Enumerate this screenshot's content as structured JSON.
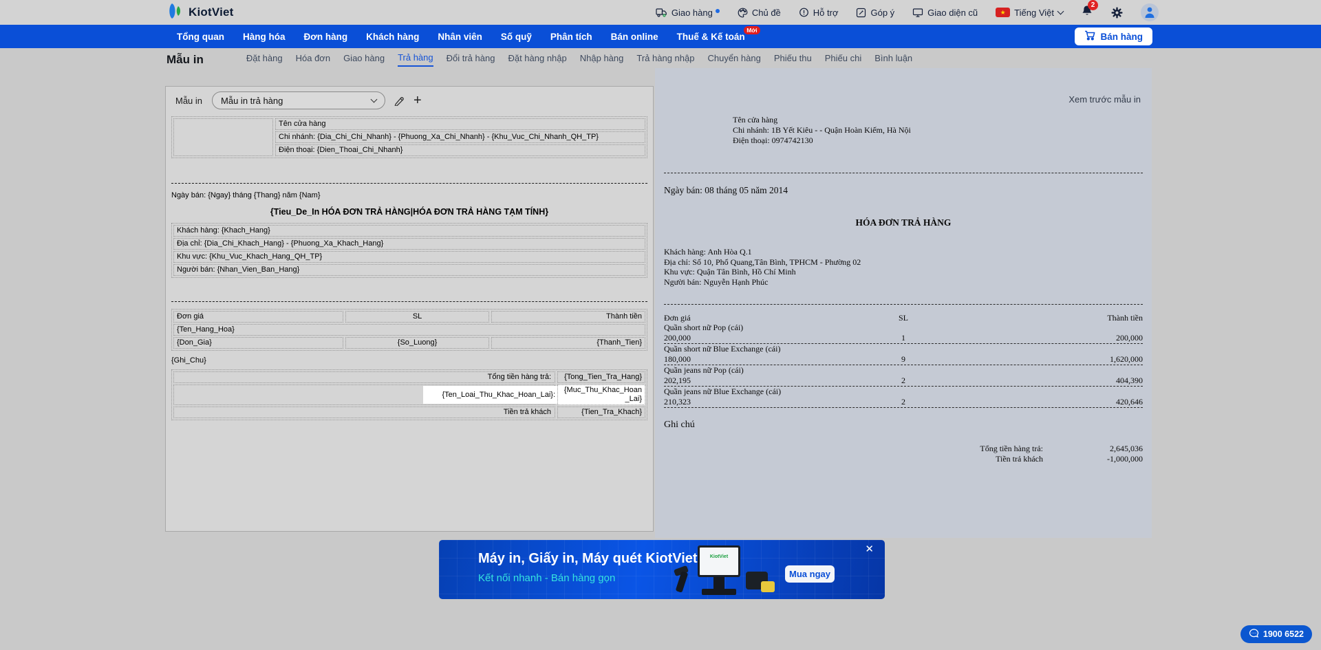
{
  "colors": {
    "accent_blue": "#0a4fd7",
    "topbar_bg": "#d3d3d3",
    "page_bg": "#c9c9c9",
    "editor_bg": "#d5d5d5",
    "preview_bg": "#c5cad4",
    "badge_red": "#e11d1d",
    "banner_cyan": "#35e3df"
  },
  "topbar": {
    "logo": "KiotViet",
    "menu": [
      {
        "label": "Giao hàng"
      },
      {
        "label": "Chủ đề"
      },
      {
        "label": "Hỗ trợ"
      },
      {
        "label": "Góp ý"
      },
      {
        "label": "Giao diện cũ"
      },
      {
        "label": "Tiếng Việt"
      }
    ],
    "flag_star": "★",
    "notification_count": "2"
  },
  "nav": {
    "items": [
      "Tổng quan",
      "Hàng hóa",
      "Đơn hàng",
      "Khách hàng",
      "Nhân viên",
      "Số quỹ",
      "Phân tích",
      "Bán online",
      "Thuế & Kế toán"
    ],
    "new_badge": "Mới",
    "sell_button": "Bán hàng"
  },
  "page": {
    "title": "Mẫu in",
    "tabs": [
      "Đặt hàng",
      "Hóa đơn",
      "Giao hàng",
      "Trả hàng",
      "Đổi trả hàng",
      "Đặt hàng nhập",
      "Nhập hàng",
      "Trả hàng nhập",
      "Chuyển hàng",
      "Phiếu thu",
      "Phiếu chi",
      "Bình luận"
    ],
    "active_tab": "Trả hàng"
  },
  "editor": {
    "panel_label": "Mẫu in",
    "template_select": "Mẫu in trả hàng",
    "tpl": {
      "store_lines": [
        "Tên cửa hàng",
        "Chi nhánh: {Dia_Chi_Chi_Nhanh} - {Phuong_Xa_Chi_Nhanh} - {Khu_Vuc_Chi_Nhanh_QH_TP}",
        "Điện thoại: {Dien_Thoai_Chi_Nhanh}"
      ],
      "date_line": "Ngày bán: {Ngay} tháng {Thang} năm {Nam}",
      "title": "{Tieu_De_In HÓA ĐƠN TRẢ HÀNG|HÓA ĐƠN TRẢ HÀNG TẠM TÍNH}",
      "customer_lines": [
        "Khách hàng: {Khach_Hang}",
        "Địa chỉ: {Dia_Chi_Khach_Hang} - {Phuong_Xa_Khach_Hang}",
        "Khu vực: {Khu_Vuc_Khach_Hang_QH_TP}",
        "Người bán: {Nhan_Vien_Ban_Hang}"
      ],
      "cols": [
        "Đơn giá",
        "SL",
        "Thành tiền"
      ],
      "item_name": "{Ten_Hang_Hoa}",
      "item_cells": [
        "{Don_Gia}",
        "{So_Luong}",
        "{Thanh_Tien}"
      ],
      "note": "{Ghi_Chu}",
      "totals": [
        {
          "label": "Tổng tiền hàng trả:",
          "value": "{Tong_Tien_Tra_Hang}"
        },
        {
          "label": "{Ten_Loai_Thu_Khac_Hoan_Lai}:",
          "value": "{Muc_Thu_Khac_Hoan_Lai}"
        },
        {
          "label": "Tiền trả khách",
          "value": "{Tien_Tra_Khach}"
        }
      ]
    }
  },
  "preview": {
    "heading": "Xem trước mẫu in",
    "store_lines": [
      "Tên cửa hàng",
      "Chi nhánh: 1B Yết Kiêu - - Quận Hoàn Kiếm, Hà Nội",
      "Điện thoại: 0974742130"
    ],
    "date_line": "Ngày bán: 08 tháng 05 năm 2014",
    "title": "HÓA ĐƠN TRẢ HÀNG",
    "customer_lines": [
      "Khách hàng: Anh Hòa Q.1",
      "Địa chỉ: Số 10, Phổ Quang,Tân Bình, TPHCM - Phường 02",
      "Khu vực: Quận Tân Bình, Hồ Chí Minh",
      "Người bán: Nguyễn Hạnh Phúc"
    ],
    "cols": [
      "Đơn giá",
      "SL",
      "Thành tiền"
    ],
    "items": [
      {
        "name": "Quần short nữ Pop (cái)",
        "price": "200,000",
        "qty": "1",
        "total": "200,000"
      },
      {
        "name": "Quần short nữ Blue Exchange (cái)",
        "price": "180,000",
        "qty": "9",
        "total": "1,620,000"
      },
      {
        "name": "Quần jeans nữ Pop (cái)",
        "price": "202,195",
        "qty": "2",
        "total": "404,390"
      },
      {
        "name": "Quần jeans nữ Blue Exchange (cái)",
        "price": "210,323",
        "qty": "2",
        "total": "420,646"
      }
    ],
    "note": "Ghi chú",
    "totals": [
      {
        "label": "Tổng tiền hàng trả:",
        "value": "2,645,036"
      },
      {
        "label": "Tiền trả khách",
        "value": "-1,000,000"
      }
    ]
  },
  "banner": {
    "title": "Máy in, Giấy in, Máy quét KiotViet",
    "subtitle": "Kết nối nhanh - Bán hàng gọn",
    "cta": "Mua ngay",
    "close": "✕",
    "screen_logo": "KiotViet"
  },
  "chat": {
    "phone": "1900 6522"
  }
}
